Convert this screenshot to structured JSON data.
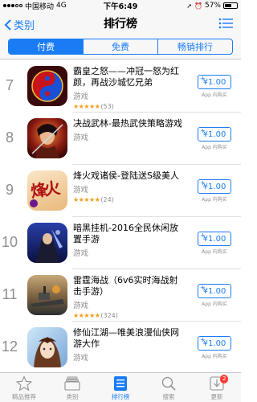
{
  "status_bar": {
    "carrier": "中国移动",
    "network": "4G",
    "time": "下午6:49",
    "battery": "57%",
    "battery_level": 0.57
  },
  "nav": {
    "back_label": "类别",
    "title": "排行榜"
  },
  "segments": [
    {
      "label": "付费",
      "active": true
    },
    {
      "label": "免费",
      "active": false
    },
    {
      "label": "畅销排行",
      "active": false
    }
  ],
  "apps": [
    {
      "rank": "7",
      "name": "霸皇之怒——冲冠一怒为红颜，再战沙城忆兄弟",
      "category": "游戏",
      "stars": "★★★★★",
      "rating_count": "(53)",
      "price": "¥1.00",
      "iap": "App 内购买"
    },
    {
      "rank": "8",
      "name": "决战武林-最热武侠策略游戏",
      "category": "游戏",
      "stars": "",
      "rating_count": "",
      "price": "¥1.00",
      "iap": "App 内购买"
    },
    {
      "rank": "9",
      "name": "烽火戏诸侯-登陆送S级美人",
      "category": "游戏",
      "stars": "★★★★★",
      "rating_count": "(24)",
      "price": "¥1.00",
      "iap": "App 内购买",
      "icon_text": "烽火"
    },
    {
      "rank": "10",
      "name": "暗黑挂机-2016全民休闲放置手游",
      "category": "游戏",
      "stars": "",
      "rating_count": "",
      "price": "¥1.00",
      "iap": "App 内购买"
    },
    {
      "rank": "11",
      "name": "雷霆海战（6v6实时海战射击手游）",
      "category": "游戏",
      "stars": "★★★★★",
      "rating_count": "(324)",
      "price": "¥1.00",
      "iap": "App 内购买"
    },
    {
      "rank": "12",
      "name": "修仙江湖—唯美浪漫仙侠网游大作",
      "category": "游戏",
      "stars": "",
      "rating_count": "",
      "price": "¥1.00",
      "iap": "App 内购买"
    }
  ],
  "tabs": [
    {
      "label": "精品推荐",
      "icon": "star-icon",
      "active": false
    },
    {
      "label": "类别",
      "icon": "categories-icon",
      "active": false
    },
    {
      "label": "排行榜",
      "icon": "top-charts-icon",
      "active": true
    },
    {
      "label": "搜索",
      "icon": "search-icon",
      "active": false
    },
    {
      "label": "更新",
      "icon": "updates-icon",
      "active": false,
      "badge": "2"
    }
  ],
  "colors": {
    "accent": "#1a7cf5",
    "star": "#f29d18",
    "badge": "#ff3b30"
  }
}
